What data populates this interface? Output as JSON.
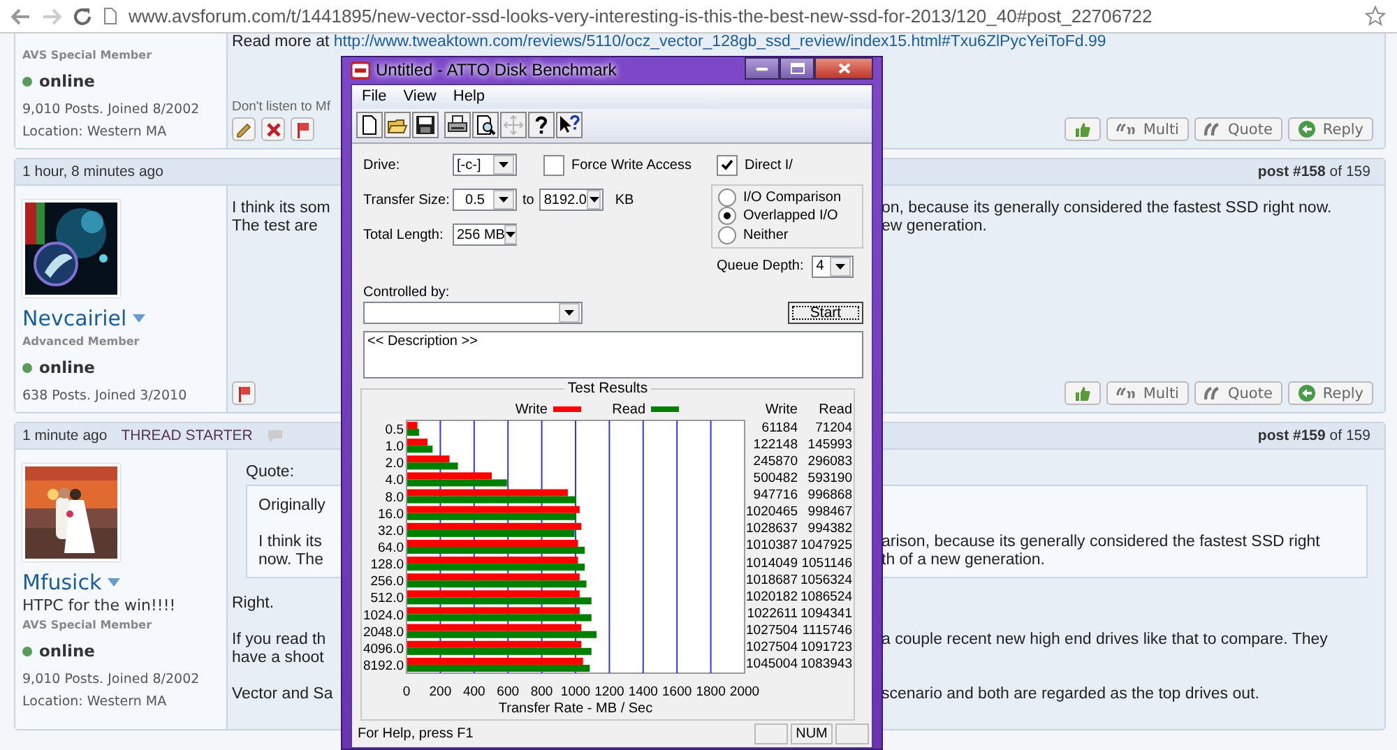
{
  "browser": {
    "url": "www.avsforum.com/t/1441895/new-vector-ssd-looks-very-interesting-is-this-the-best-new-ssd-for-2013/120_40#post_22706722"
  },
  "posts": [
    {
      "user": {
        "rank": "AVS Special Member",
        "status": "online",
        "stats": "9,010 Posts. Joined 8/2002",
        "location": "Location: Western MA"
      },
      "content": [
        {
          "kind": "link_line",
          "text": "Read more at",
          "link": "http://www.tweaktown.com/reviews/5110/ocz_vector_128gb_ssd_review/index15.html#Txu6ZlPycYeiToFd.99"
        },
        {
          "kind": "signature",
          "left": "Don't listen to Mf"
        }
      ],
      "tools": [
        {
          "kind": "edit"
        },
        {
          "kind": "delete"
        },
        {
          "kind": "report"
        }
      ],
      "actions": [
        {
          "kind": "like"
        },
        {
          "kind": "multi",
          "label": "Multi"
        },
        {
          "kind": "quote",
          "label": "Quote"
        },
        {
          "kind": "reply",
          "label": "Reply"
        }
      ]
    },
    {
      "time": "1 hour, 8 minutes ago",
      "number": "post #158",
      "of": "of 159",
      "user": {
        "name": "Nevcairiel",
        "rank": "Advanced Member",
        "status": "online",
        "stats": "638 Posts. Joined 3/2010"
      },
      "content": [
        {
          "kind": "paragraph",
          "lines": [
            {
              "left": "I think its som",
              "right": "on, because its generally considered the fastest SSD right now."
            },
            {
              "left": "The test are",
              "right": "ew generation."
            }
          ]
        }
      ],
      "tools": [
        {
          "kind": "report"
        }
      ],
      "actions": [
        {
          "kind": "like"
        },
        {
          "kind": "multi",
          "label": "Multi"
        },
        {
          "kind": "quote",
          "label": "Quote"
        },
        {
          "kind": "reply",
          "label": "Reply"
        }
      ]
    },
    {
      "time": "1 minute ago",
      "badge": "THREAD STARTER",
      "number": "post #159",
      "of": "of 159",
      "user": {
        "name": "Mfusick",
        "title": "HTPC for the win!!!!",
        "rank": "AVS Special Member",
        "status": "online",
        "stats": "9,010 Posts. Joined 8/2002",
        "location": "Location: Western MA"
      },
      "content": [
        {
          "kind": "quote",
          "label": "Quote:",
          "paragraphs": [
            {
              "lines": [
                {
                  "left": "Originally"
                }
              ]
            },
            {
              "lines": [
                {
                  "left": "I think its",
                  "right": "arison, because its generally considered the fastest SSD right"
                },
                {
                  "left": "now. The",
                  "right": "th of a new generation."
                }
              ]
            }
          ]
        },
        {
          "kind": "paragraph",
          "lines": [
            {
              "left": "Right."
            }
          ]
        },
        {
          "kind": "paragraph",
          "lines": [
            {
              "left": "If you read th",
              "right": "a couple recent new high end drives like that to compare. They"
            },
            {
              "left": "have a shoot"
            }
          ]
        },
        {
          "kind": "paragraph",
          "lines": [
            {
              "left": "Vector and Sa",
              "right": "scenario and both are regarded as the top drives out."
            }
          ]
        }
      ]
    }
  ],
  "atto": {
    "title": "Untitled - ATTO Disk Benchmark",
    "menu": [
      "File",
      "View",
      "Help"
    ],
    "toolbar": [
      {
        "buttons": [
          {
            "kind": "new",
            "disabled": false
          },
          {
            "kind": "open",
            "disabled": false
          },
          {
            "kind": "save",
            "disabled": false
          }
        ]
      },
      {
        "buttons": [
          {
            "kind": "print",
            "disabled": false
          },
          {
            "kind": "preview",
            "disabled": false
          },
          {
            "kind": "move",
            "disabled": true
          },
          {
            "kind": "help",
            "disabled": false
          },
          {
            "kind": "context_help",
            "disabled": false
          }
        ]
      }
    ],
    "drive": {
      "label": "Drive:",
      "value": "[-c-]"
    },
    "transfer_size": {
      "label": "Transfer Size:",
      "from": "0.5",
      "to_label": "to",
      "to": "8192.0",
      "unit": "KB"
    },
    "total_length": {
      "label": "Total Length:",
      "value": "256 MB"
    },
    "force_write": {
      "label": "Force Write Access",
      "checked": false
    },
    "direct_io": {
      "label": "Direct I/",
      "checked": true
    },
    "mode": [
      {
        "label": "I/O Comparison",
        "selected": false
      },
      {
        "label": "Overlapped I/O",
        "selected": true
      },
      {
        "label": "Neither",
        "selected": false
      }
    ],
    "queue_depth": {
      "label": "Queue Depth:",
      "value": "4"
    },
    "controlled_by": {
      "label": "Controlled by:"
    },
    "start": "Start",
    "description": "<< Description >>",
    "results": {
      "title": "Test Results",
      "columns": [
        "Write",
        "Read"
      ],
      "rows": [
        [
          "61184",
          "71204"
        ],
        [
          "122148",
          "145993"
        ],
        [
          "245870",
          "296083"
        ],
        [
          "500482",
          "593190"
        ],
        [
          "947716",
          "996868"
        ],
        [
          "1020465",
          "998467"
        ],
        [
          "1028637",
          "994382"
        ],
        [
          "1010387",
          "1047925"
        ],
        [
          "1014049",
          "1051146"
        ],
        [
          "1018687",
          "1056324"
        ],
        [
          "1020182",
          "1086524"
        ],
        [
          "1022611",
          "1094341"
        ],
        [
          "1027504",
          "1115746"
        ],
        [
          "1027504",
          "1091723"
        ],
        [
          "1045004",
          "1083943"
        ]
      ],
      "chart_data": {
        "type": "bar",
        "orientation": "horizontal",
        "xlabel": "Transfer Rate - MB / Sec",
        "categories": [
          "0.5",
          "1.0",
          "2.0",
          "4.0",
          "8.0",
          "16.0",
          "32.0",
          "64.0",
          "128.0",
          "256.0",
          "512.0",
          "1024.0",
          "2048.0",
          "4096.0",
          "8192.0"
        ],
        "series": [
          {
            "name": "Write",
            "color": "#ff0000",
            "values": [
              60,
              120,
              250,
              500,
              950,
              1020,
              1030,
              1010,
              1010,
              1020,
              1020,
              1020,
              1030,
              1030,
              1040
            ]
          },
          {
            "name": "Read",
            "color": "#008000",
            "values": [
              70,
              150,
              300,
              590,
              1000,
              1000,
              990,
              1050,
              1050,
              1060,
              1090,
              1090,
              1120,
              1090,
              1080
            ]
          }
        ],
        "xlim": [
          0,
          2000
        ],
        "xticks": [
          0,
          200,
          400,
          600,
          800,
          1000,
          1200,
          1400,
          1600,
          1800,
          2000
        ],
        "grid": true,
        "legend": true
      }
    },
    "status_bar": {
      "text": "For Help, press F1",
      "num": "NUM"
    }
  }
}
